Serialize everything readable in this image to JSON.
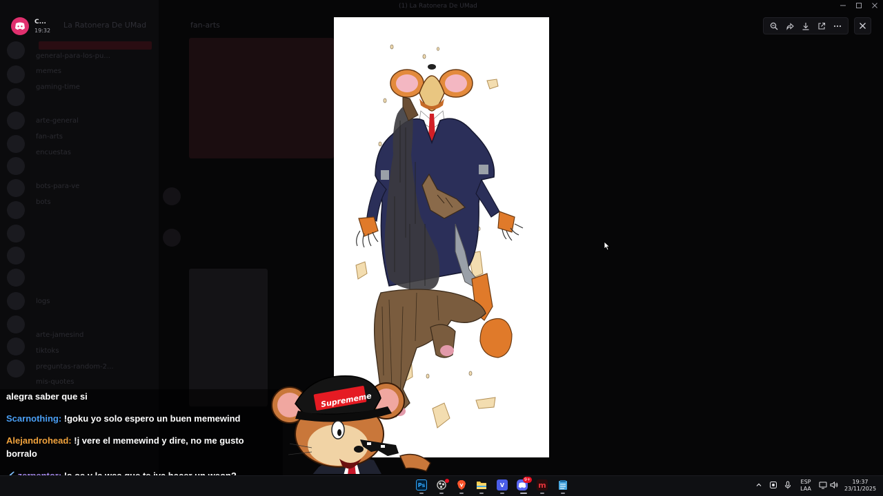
{
  "window": {
    "title": "(1) La Ratonera De UMad",
    "minimize_icon": "minimize-icon",
    "maximize_icon": "maximize-icon",
    "close_icon": "close-icon"
  },
  "notification": {
    "app_icon": "discord-icon",
    "name": "C...",
    "time": "19:32",
    "accent": "#e0306e"
  },
  "discord_background": {
    "server_name": "La Ratonera De UMad",
    "current_channel": "fan-arts",
    "channels": [
      "general-para-los-pu...",
      "memes",
      "gaming-time",
      "arte-general",
      "fan-arts",
      "encuestas",
      "bots",
      "bots-para-ve",
      "logs",
      "tiktoks",
      "preguntas-random-2...",
      "mis-quotes",
      "arte-jamesind"
    ]
  },
  "viewer": {
    "toolbar": [
      {
        "name": "zoom-in",
        "icon": "zoom-icon"
      },
      {
        "name": "forward",
        "icon": "forward-icon"
      },
      {
        "name": "download",
        "icon": "download-icon"
      },
      {
        "name": "open-in-browser",
        "icon": "external-link-icon"
      },
      {
        "name": "more",
        "icon": "more-icon"
      }
    ],
    "close_icon": "close-icon",
    "image_description_icon": "fan-art-image"
  },
  "stream_chat": [
    {
      "user": "",
      "text": "alegra saber que si",
      "color": "#ffffff"
    },
    {
      "user": "Scarnothing:",
      "text": " !goku yo solo espero un buen memewind",
      "color": "#4a9ff5"
    },
    {
      "user": "Alejandrohead:",
      "text": " !j vere el memewind y dire, no me gusto borralo",
      "color": "#f0a23c"
    },
    {
      "user": "zerpentor:",
      "text": " !s oe y la wea que te iva hacer un weon?",
      "color": "#a98cf2",
      "badge": "sword-icon"
    }
  ],
  "mascot": {
    "cap_text": "Suprememe",
    "icon": "mouse-mascot-icon"
  },
  "taskbar": {
    "apps": [
      {
        "name": "photoshop",
        "label": "Ps",
        "color": "#001e36",
        "text_color": "#31a8ff"
      },
      {
        "name": "obs",
        "label": "",
        "color": "#222"
      },
      {
        "name": "brave",
        "label": "",
        "color": "#fb542b"
      },
      {
        "name": "file-explorer",
        "label": "",
        "color": "#f2c94c"
      },
      {
        "name": "vegas",
        "label": "V",
        "color": "#4a5de8"
      },
      {
        "name": "discord",
        "label": "",
        "color": "#5865f2",
        "badge": "9+"
      },
      {
        "name": "app-m",
        "label": "m",
        "color": "#2b0b0b",
        "text_color": "#e2333a"
      },
      {
        "name": "notepad",
        "label": "",
        "color": "#4aa8e0"
      }
    ],
    "tray": {
      "language_top": "ESP",
      "language_bottom": "LAA",
      "time": "19:37",
      "date": "23/11/2025"
    }
  }
}
